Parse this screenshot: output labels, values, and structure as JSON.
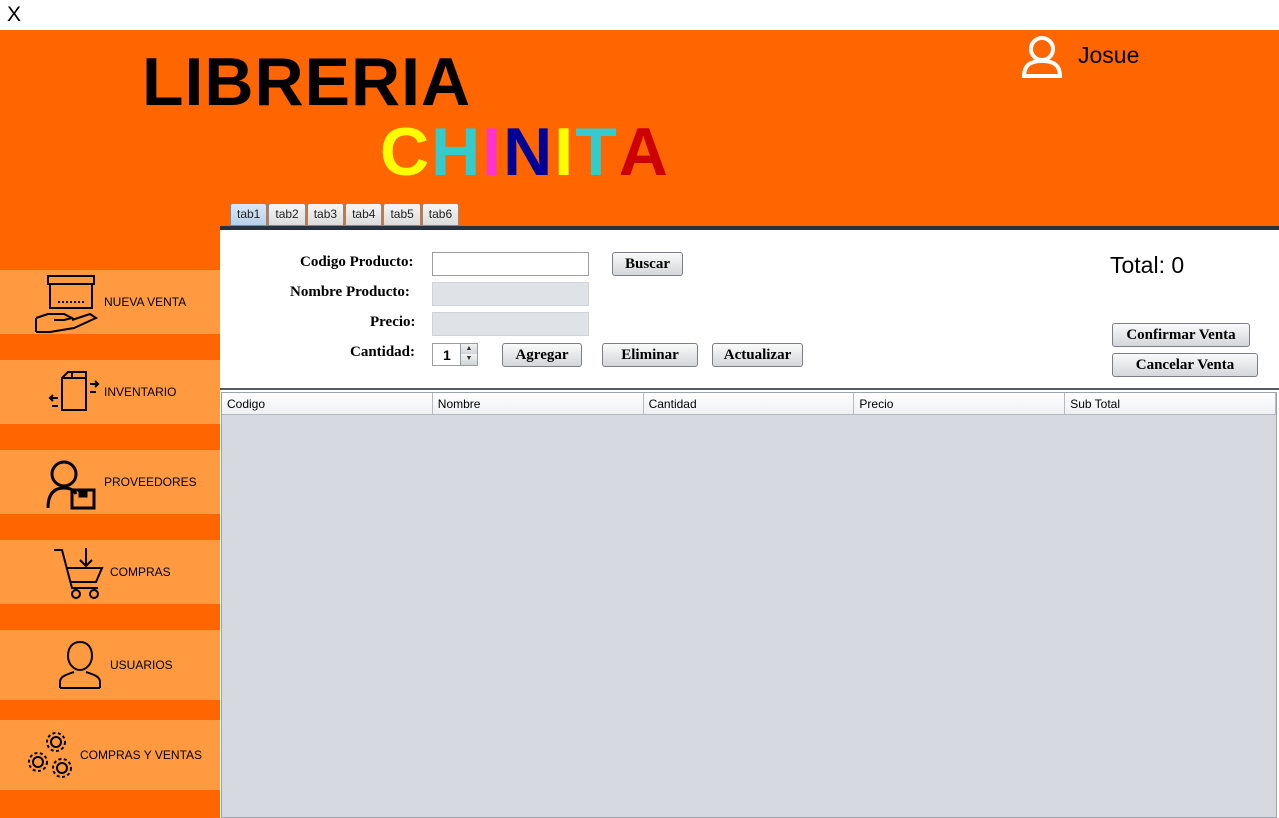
{
  "window": {
    "close_label": "X"
  },
  "header": {
    "title_line1": "LIBRERIA",
    "title_line2_letters": [
      {
        "char": "C",
        "color": "#ffff00"
      },
      {
        "char": "H",
        "color": "#33cccc"
      },
      {
        "char": "I",
        "color": "#ff33cc"
      },
      {
        "char": "N",
        "color": "#000099"
      },
      {
        "char": "I",
        "color": "#ffff00"
      },
      {
        "char": "T",
        "color": "#33cccc"
      },
      {
        "char": "A",
        "color": "#cc0000"
      }
    ],
    "user_name": "Josue"
  },
  "sidebar": {
    "items": [
      {
        "label": "NUEVA VENTA",
        "icon": "box-hand-icon"
      },
      {
        "label": "INVENTARIO",
        "icon": "box-arrows-icon"
      },
      {
        "label": "PROVEEDORES",
        "icon": "supplier-icon"
      },
      {
        "label": "COMPRAS",
        "icon": "cart-icon"
      },
      {
        "label": "USUARIOS",
        "icon": "user-icon"
      },
      {
        "label": "COMPRAS Y VENTAS",
        "icon": "gears-icon"
      }
    ]
  },
  "tabs": [
    "tab1",
    "tab2",
    "tab3",
    "tab4",
    "tab5",
    "tab6"
  ],
  "active_tab": "tab1",
  "form": {
    "codigo_label": "Codigo Producto:",
    "nombre_label": "Nombre Producto:",
    "precio_label": "Precio:",
    "cantidad_label": "Cantidad:",
    "codigo_value": "",
    "nombre_value": "",
    "precio_value": "",
    "cantidad_value": "1",
    "buscar_label": "Buscar",
    "agregar_label": "Agregar",
    "eliminar_label": "Eliminar",
    "actualizar_label": "Actualizar",
    "total_label": "Total: 0",
    "confirmar_label": "Confirmar Venta",
    "cancelar_label": "Cancelar Venta"
  },
  "table": {
    "columns": [
      "Codigo",
      "Nombre",
      "Cantidad",
      "Precio",
      "Sub Total"
    ],
    "rows": []
  },
  "colors": {
    "header_bg": "#ff6600",
    "sidebar_item_bg": "#ff9a40",
    "table_bg": "#d6d9e0"
  }
}
